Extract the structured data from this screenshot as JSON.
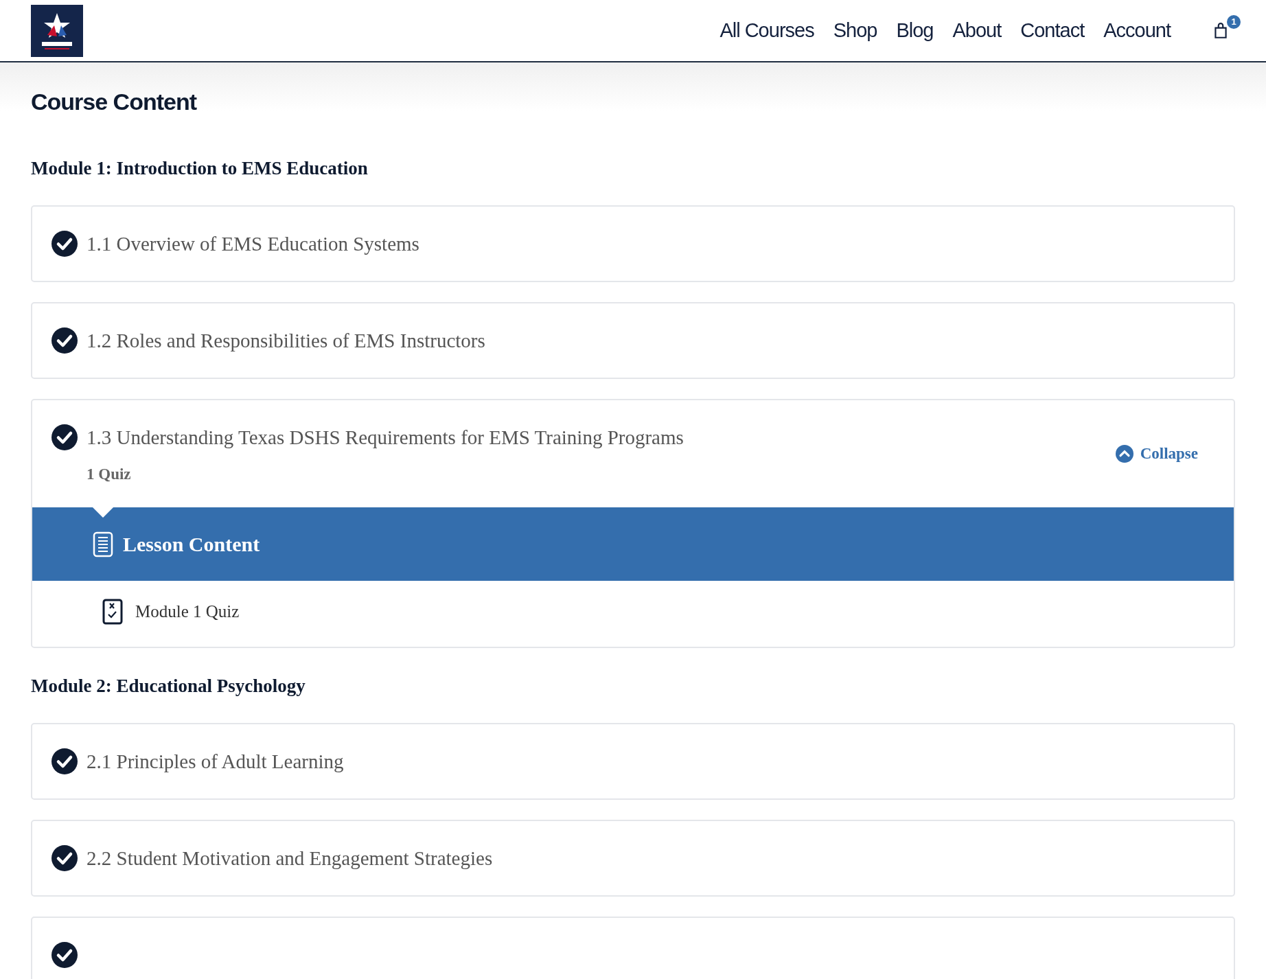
{
  "header": {
    "nav": [
      {
        "label": "All Courses"
      },
      {
        "label": "Shop"
      },
      {
        "label": "Blog"
      },
      {
        "label": "About"
      },
      {
        "label": "Contact"
      },
      {
        "label": "Account"
      }
    ],
    "cart_count": "1"
  },
  "page_title": "Course Content",
  "modules": [
    {
      "title": "Module 1: Introduction to EMS Education",
      "lessons": [
        {
          "title": "1.1 Overview of EMS Education Systems",
          "completed": true,
          "expanded": false
        },
        {
          "title": "1.2 Roles and Responsibilities of EMS Instructors",
          "completed": true,
          "expanded": false
        },
        {
          "title": "1.3 Understanding Texas DSHS Requirements for EMS Training Programs",
          "completed": true,
          "expanded": true,
          "meta": "1 Quiz",
          "toggle": "Collapse",
          "content_heading": "Lesson Content",
          "items": [
            {
              "title": "Module 1 Quiz",
              "kind": "quiz"
            }
          ]
        }
      ]
    },
    {
      "title": "Module 2: Educational Psychology",
      "lessons": [
        {
          "title": "2.1 Principles of Adult Learning",
          "completed": true,
          "expanded": false
        },
        {
          "title": "2.2 Student Motivation and Engagement Strategies",
          "completed": true,
          "expanded": false
        },
        {
          "completed": true,
          "expanded": false
        }
      ]
    }
  ]
}
